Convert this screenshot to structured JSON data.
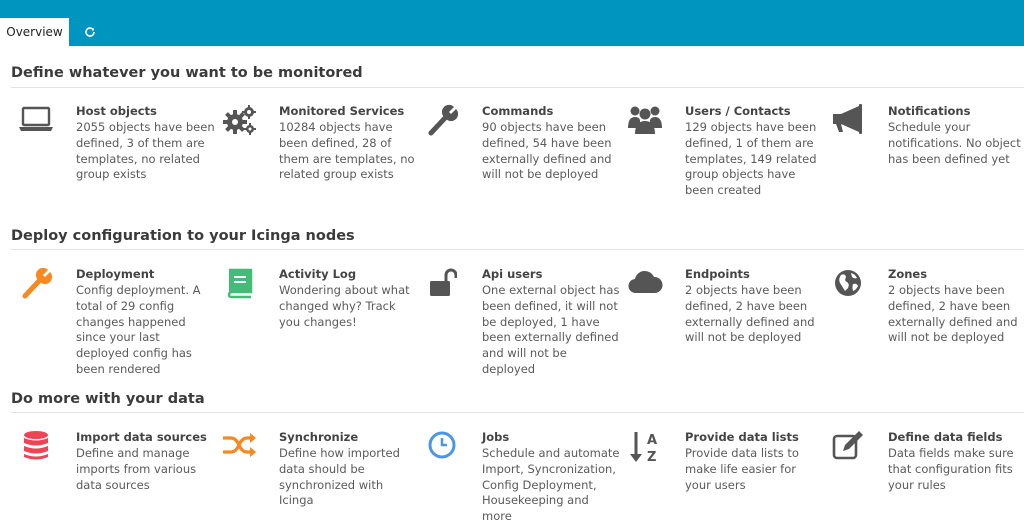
{
  "header": {
    "tab_overview": "Overview",
    "refresh_icon": "refresh-icon"
  },
  "colors": {
    "topbar": "#0095bf",
    "orange": "#f6891f",
    "green": "#44bb77",
    "red": "#ee4455",
    "blue": "#4b96e8",
    "gray": "#555555"
  },
  "sections": [
    {
      "title": "Define whatever you want to be monitored",
      "tiles": [
        {
          "icon": "laptop-icon",
          "title": "Host objects",
          "desc": "2055 objects have been defined, 3 of them are templates, no related group exists"
        },
        {
          "icon": "gears-icon",
          "title": "Monitored Services",
          "desc": "10284 objects have been defined, 28 of them are templates, no related group exists"
        },
        {
          "icon": "wrench-icon",
          "title": "Commands",
          "desc": "90 objects have been defined, 54 have been externally defined and will not be deployed"
        },
        {
          "icon": "users-icon",
          "title": "Users / Contacts",
          "desc": "129 objects have been defined, 1 of them are templates, 149 related group objects have been created"
        },
        {
          "icon": "megaphone-icon",
          "title": "Notifications",
          "desc": "Schedule your notifications. No object has been defined yet"
        }
      ]
    },
    {
      "title": "Deploy configuration to your Icinga nodes",
      "tiles": [
        {
          "icon": "wrench-icon",
          "title": "Deployment",
          "desc": "Config deployment. A total of 29 config changes happened since your last deployed config has been rendered"
        },
        {
          "icon": "book-icon",
          "title": "Activity Log",
          "desc": "Wondering about what changed why? Track you changes!"
        },
        {
          "icon": "lock-open-icon",
          "title": "Api users",
          "desc": "One external object has been defined, it will not be deployed, 1 have been externally defined and will not be deployed"
        },
        {
          "icon": "cloud-icon",
          "title": "Endpoints",
          "desc": "2 objects have been defined, 2 have been externally defined and will not be deployed"
        },
        {
          "icon": "globe-icon",
          "title": "Zones",
          "desc": "2 objects have been defined, 2 have been externally defined and will not be deployed"
        }
      ]
    },
    {
      "title": "Do more with your data",
      "tiles": [
        {
          "icon": "database-icon",
          "title": "Import data sources",
          "desc": "Define and manage imports from various data sources"
        },
        {
          "icon": "shuffle-icon",
          "title": "Synchronize",
          "desc": "Define how imported data should be synchronized with Icinga"
        },
        {
          "icon": "clock-icon",
          "title": "Jobs",
          "desc": "Schedule and automate Import, Syncronization, Config Deployment, Housekeeping and more"
        },
        {
          "icon": "sort-alpha-icon",
          "title": "Provide data lists",
          "desc": "Provide data lists to make life easier for your users"
        },
        {
          "icon": "edit-icon",
          "title": "Define data fields",
          "desc": "Data fields make sure that configuration fits your rules"
        }
      ]
    }
  ]
}
